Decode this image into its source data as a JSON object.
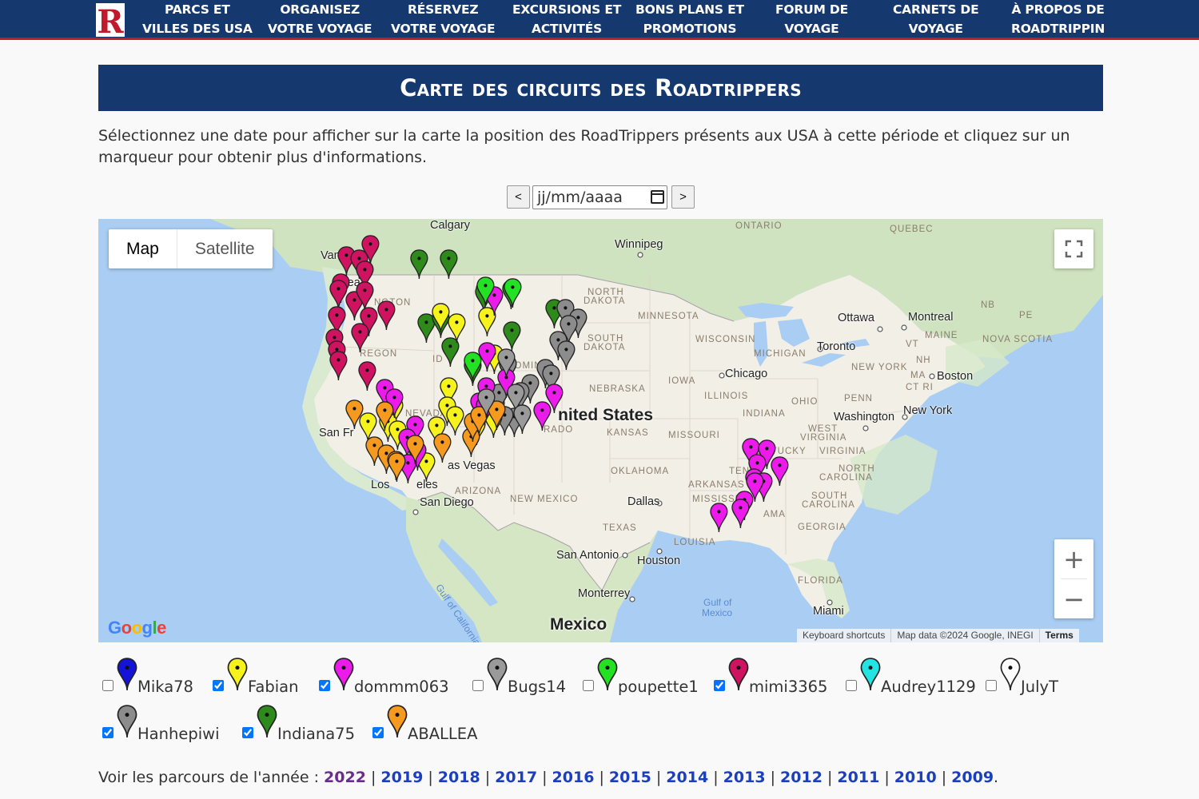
{
  "nav": {
    "items": [
      {
        "line1": "PARCS ET",
        "line2": "VILLES DES USA"
      },
      {
        "line1": "ORGANISEZ",
        "line2": "VOTRE VOYAGE"
      },
      {
        "line1": "RÉSERVEZ",
        "line2": "VOTRE VOYAGE"
      },
      {
        "line1": "EXCURSIONS ET",
        "line2": "ACTIVITÉS"
      },
      {
        "line1": "BONS PLANS ET",
        "line2": "PROMOTIONS"
      },
      {
        "line1": "FORUM DE",
        "line2": "VOYAGE"
      },
      {
        "line1": "CARNETS DE",
        "line2": "VOYAGE"
      },
      {
        "line1": "À PROPOS DE",
        "line2": "ROADTRIPPIN"
      }
    ],
    "logo_letter": "R"
  },
  "page": {
    "title": "Carte des circuits des Roadtrippers",
    "intro": "Sélectionnez une date pour afficher sur la carte la position des RoadTrippers présents aux USA à cette période et cliquez sur un marqueur pour obtenir plus d'informations."
  },
  "date_control": {
    "prev_label": "<",
    "next_label": ">",
    "placeholder": "jj/mm/aaaa"
  },
  "map": {
    "type_map": "Map",
    "type_satellite": "Satellite",
    "zoom_in": "+",
    "zoom_out": "−",
    "attribution": {
      "shortcuts": "Keyboard shortcuts",
      "data": "Map data ©2024 Google, INEGI",
      "terms": "Terms"
    },
    "google": "Google",
    "labels": {
      "calgary": "Calgary",
      "winnipeg": "Winnipeg",
      "ontario": "ONTARIO",
      "quebec": "QUEBEC",
      "vancouver": "Vancou",
      "washington_state": "NGTON",
      "seattle": "Sea",
      "oregon": "REGON",
      "idaho": "ID",
      "wyoming": "WYOMING",
      "north_dakota_1": "NORTH",
      "north_dakota_2": "DAKOTA",
      "south_dakota_1": "SOUTH",
      "south_dakota_2": "DAKOTA",
      "minnesota": "MINNESOTA",
      "wisconsin": "WISCONSIN",
      "michigan": "MICHIGAN",
      "nb": "NB",
      "pe": "PE",
      "montreal": "Montreal",
      "ottawa": "Ottawa",
      "toronto": "Toronto",
      "maine": "MAINE",
      "nova_scotia": "NOVA SCOTIA",
      "vt": "VT",
      "nh": "NH",
      "ma": "MA",
      "boston": "Boston",
      "ct_ri": "CT RI",
      "new_york_state": "NEW YORK",
      "chicago": "Chicago",
      "iowa": "IOWA",
      "nebraska": "NEBRASKA",
      "illinois": "ILLINOIS",
      "ohio": "OHIO",
      "penn": "PENN",
      "indiana": "INDIANA",
      "new_york_city": "New York",
      "washington_dc": "Washington",
      "united_states": "nited States",
      "nevada": "NEVADA",
      "colorado": "RADO",
      "kansas": "KANSAS",
      "missouri": "MISSOURI",
      "west_virginia_1": "WEST",
      "west_virginia_2": "VIRGINIA",
      "virginia": "VIRGINIA",
      "kentucky": "KENTUCKY",
      "san_francisco": "San Fr",
      "las_vegas": "as Vegas",
      "los_angeles": "Los",
      "los_angeles_2": "eles",
      "san_diego": "San Diego",
      "arizona": "ARIZONA",
      "new_mexico": "NEW MEXICO",
      "oklahoma": "OKLAHOMA",
      "arkansas": "ARKANSAS",
      "tennessee": "TEN",
      "north_carolina_1": "NORTH",
      "north_carolina_2": "CAROLINA",
      "south_carolina_1": "SOUTH",
      "south_carolina_2": "CAROLINA",
      "dallas": "Dallas",
      "mississippi": "MISSISSIP",
      "alabama": "AMA",
      "georgia": "GEORGIA",
      "texas": "TEXAS",
      "louisiana": "LOUISIA",
      "san_antonio": "San Antonio",
      "houston": "Houston",
      "florida": "FLORIDA",
      "miami": "Miami",
      "monterrey": "Monterrey",
      "mexico": "Mexico",
      "gulf_mexico_1": "Gulf of",
      "gulf_mexico_2": "Mexico",
      "gulf_california": "Gulf of California"
    }
  },
  "legend": {
    "items": [
      {
        "name": "Mika78",
        "color": "#1414d8",
        "checked": false
      },
      {
        "name": "Fabian",
        "color": "#f6f21c",
        "checked": true
      },
      {
        "name": "dommm063",
        "color": "#ec1bec",
        "checked": true
      },
      {
        "name": "Bugs14",
        "color": "#9a9a9a",
        "checked": false
      },
      {
        "name": "poupette1",
        "color": "#23e223",
        "checked": false
      },
      {
        "name": "mimi3365",
        "color": "#cf1360",
        "checked": true
      },
      {
        "name": "Audrey1129",
        "color": "#23e3e3",
        "checked": false
      },
      {
        "name": "JulyT",
        "color": "#ffffff",
        "checked": false
      },
      {
        "name": "Hanhepiwi",
        "color": "#8c8c8c",
        "checked": true
      },
      {
        "name": "Indiana75",
        "color": "#2e8a1a",
        "checked": true
      },
      {
        "name": "ABALLEA",
        "color": "#f59a1e",
        "checked": true
      }
    ]
  },
  "years": {
    "prefix": "Voir les parcours de l'année : ",
    "list": [
      "2022",
      "2019",
      "2018",
      "2017",
      "2016",
      "2015",
      "2014",
      "2013",
      "2012",
      "2011",
      "2010",
      "2009"
    ],
    "suffix": "."
  },
  "colors": {
    "navy": "#15386e",
    "accent_red": "#c01a2c",
    "link": "#1a3fbf",
    "link_visited": "#6a2c8e"
  }
}
